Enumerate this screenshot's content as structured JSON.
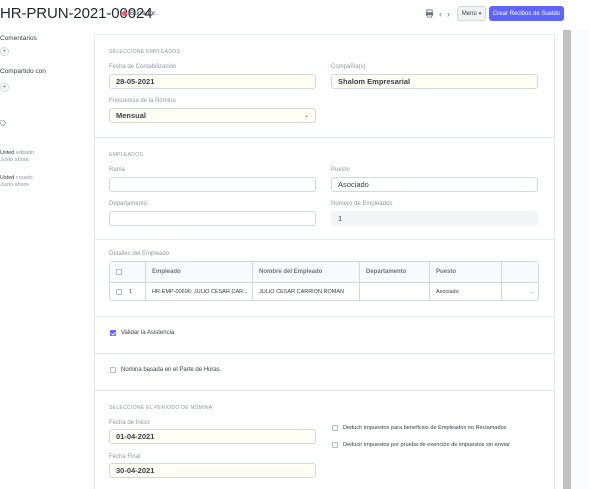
{
  "header": {
    "doc_title": "HR-PRUN-2021-00024",
    "status": "Borrador.",
    "print_icon": "print-icon",
    "prev_icon": "chevron-left-icon",
    "next_icon": "chevron-right-icon",
    "menu_label": "Menú",
    "primary_label": "Crear Recibos de Sueldo",
    "primary_color": "#5e64ff",
    "status_color": "#ff5858"
  },
  "sidebar": {
    "comments_label": "Comentarios",
    "shared_label": "Compartido con",
    "add_symbol": "+",
    "tags_icon": "tag-icon",
    "activity": [
      {
        "user": "Usted",
        "action": "editado",
        "time": "Justo ahora"
      },
      {
        "user": "Usted",
        "action": "creado",
        "time": "Justo ahora"
      }
    ]
  },
  "sec_employees_select": {
    "title": "SELECCIONE EMPLEADOS",
    "posting_date_label": "Fecha de Contabilización",
    "posting_date_value": "28-05-2021",
    "company_label": "Compañía(s)",
    "company_value": "Shalom Empresarial",
    "frequency_label": "Frecuencia de la Nómina",
    "frequency_value": "Mensual"
  },
  "sec_employees": {
    "title": "EMPLEADOS",
    "branch_label": "Rama",
    "branch_value": "",
    "designation_label": "Puesto",
    "designation_value": "Asociado",
    "department_label": "Departamento",
    "department_value": "",
    "count_label": "Número de Empleados",
    "count_value": "1"
  },
  "employee_table": {
    "label": "Detalles del Empleado",
    "headers": [
      "Empleado",
      "Nombre del Empleado",
      "Departamento",
      "Puesto"
    ],
    "rows": [
      {
        "idx": "1",
        "employee": "HR-EMP-00696: JULIO CESAR CAR...",
        "name": "JULIO CESAR CARRION ROMAN",
        "department": "",
        "designation": "Asociado"
      }
    ]
  },
  "validate_attendance": {
    "label": "Validar la Asistencia",
    "checked": true
  },
  "timesheet": {
    "label": "Nomina basada en el Parte de Horas",
    "checked": false
  },
  "sec_period": {
    "title": "SELECCIONE EL PERÍODO DE NÓMINA",
    "start_label": "Fecha de Inicio",
    "start_value": "01-04-2021",
    "end_label": "Fecha Final",
    "end_value": "30-04-2021",
    "deduct_unclaimed_label": "Deducir impuestos para beneficios de Empleados no Reclamados",
    "deduct_unsubmitted_label": "Deducir impuestos por prueba de exención de impuestos sin enviar"
  }
}
